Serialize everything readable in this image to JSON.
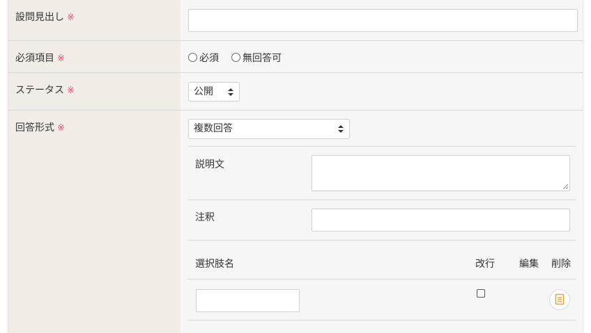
{
  "required_mark": "※",
  "fields": {
    "heading": {
      "label": "設問見出し",
      "value": ""
    },
    "required": {
      "label": "必須項目",
      "options": [
        "必須",
        "無回答可"
      ]
    },
    "status": {
      "label": "ステータス",
      "selected": "公開"
    },
    "answer_format": {
      "label": "回答形式",
      "selected": "複数回答"
    }
  },
  "sub_fields": {
    "description": {
      "label": "説明文",
      "value": ""
    },
    "note": {
      "label": "注釈",
      "value": ""
    }
  },
  "choices_table": {
    "headers": {
      "name": "選択肢名",
      "line_break": "改行",
      "edit": "編集",
      "delete": "削除"
    },
    "rows": [
      {
        "name": "",
        "line_break": false
      }
    ]
  },
  "colors": {
    "label_bg": "#f1ece6",
    "field_bg": "#f6f6f6",
    "required": "#e0526a",
    "delete_icon": "#f0a030"
  },
  "icons": {
    "delete": "document-icon"
  }
}
